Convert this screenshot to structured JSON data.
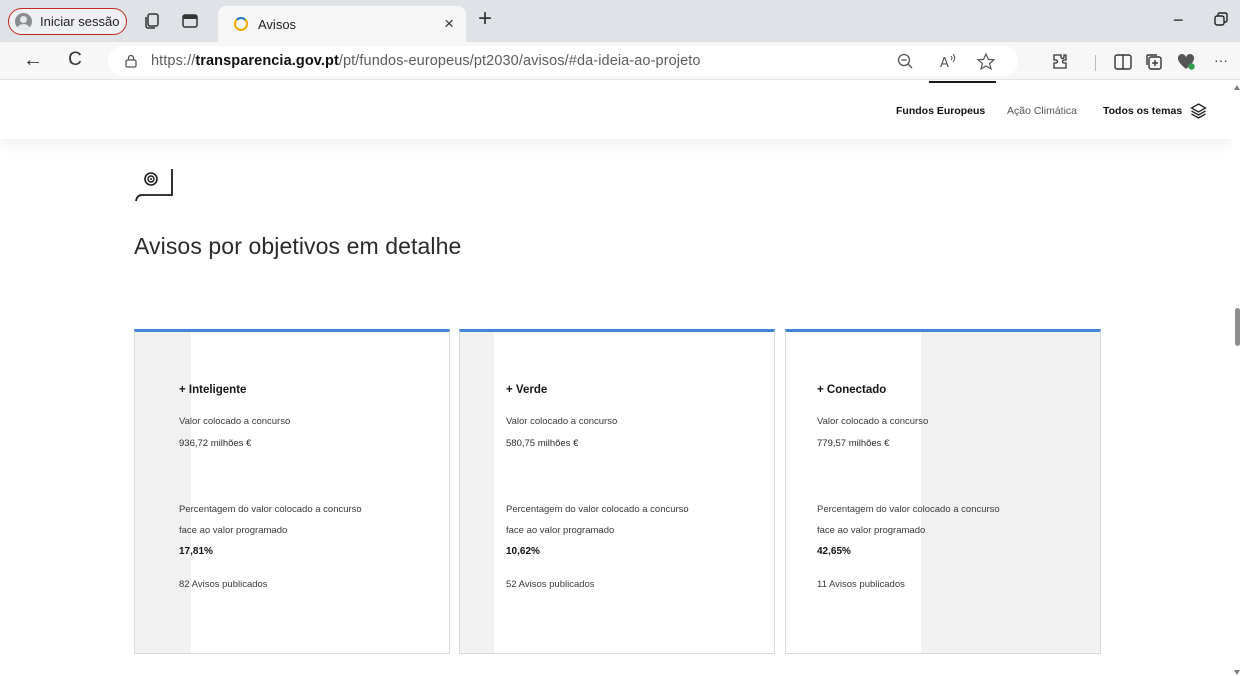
{
  "browser": {
    "profile_label": "Iniciar sessão",
    "tab_title": "Avisos",
    "tab_close": "×",
    "new_tab": "+",
    "minimize": "−",
    "back": "←",
    "reload": "C",
    "url_prefix": "https://",
    "url_domain": "transparencia.gov.pt",
    "url_path": "/pt/fundos-europeus/pt2030/avisos/#da-ideia-ao-projeto",
    "more": "···"
  },
  "site_nav": {
    "items": [
      {
        "label": "Fundos Europeus"
      },
      {
        "label": "Ação Climática"
      },
      {
        "label": "Todos os temas"
      }
    ]
  },
  "section": {
    "title": "Avisos por objetivos em detalhe"
  },
  "cards": [
    {
      "title": "+ Inteligente",
      "value_label": "Valor colocado a concurso",
      "value": "936,72 milhões €",
      "pct_label_1": "Percentagem do valor colocado a concurso",
      "pct_label_2": "face ao valor programado",
      "pct": "17,81%",
      "count": "82 Avisos publicados"
    },
    {
      "title": "+ Verde",
      "value_label": "Valor colocado a concurso",
      "value": "580,75 milhões €",
      "pct_label_1": "Percentagem do valor colocado a concurso",
      "pct_label_2": "face ao valor programado",
      "pct": "10,62%",
      "count": "52 Avisos publicados"
    },
    {
      "title": "+ Conectado",
      "value_label": "Valor colocado a concurso",
      "value": "779,57 milhões €",
      "pct_label_1": "Percentagem do valor colocado a concurso",
      "pct_label_2": "face ao valor programado",
      "pct": "42,65%",
      "count": "11 Avisos publicados"
    }
  ],
  "colors": {
    "card_accent": "#3f86d8",
    "profile_border": "#c42b1c",
    "card_stripe": "#f1f1f1"
  },
  "icons": [
    "profile-avatar-icon",
    "workspaces-icon",
    "tab-actions-icon",
    "loading-favicon",
    "back-arrow-icon",
    "reload-icon",
    "site-info-icon",
    "zoom-out-icon",
    "read-aloud-icon",
    "favorite-star-icon",
    "extensions-icon",
    "split-screen-icon",
    "collections-icon",
    "browser-essentials-icon",
    "layers-icon",
    "target-icon"
  ]
}
